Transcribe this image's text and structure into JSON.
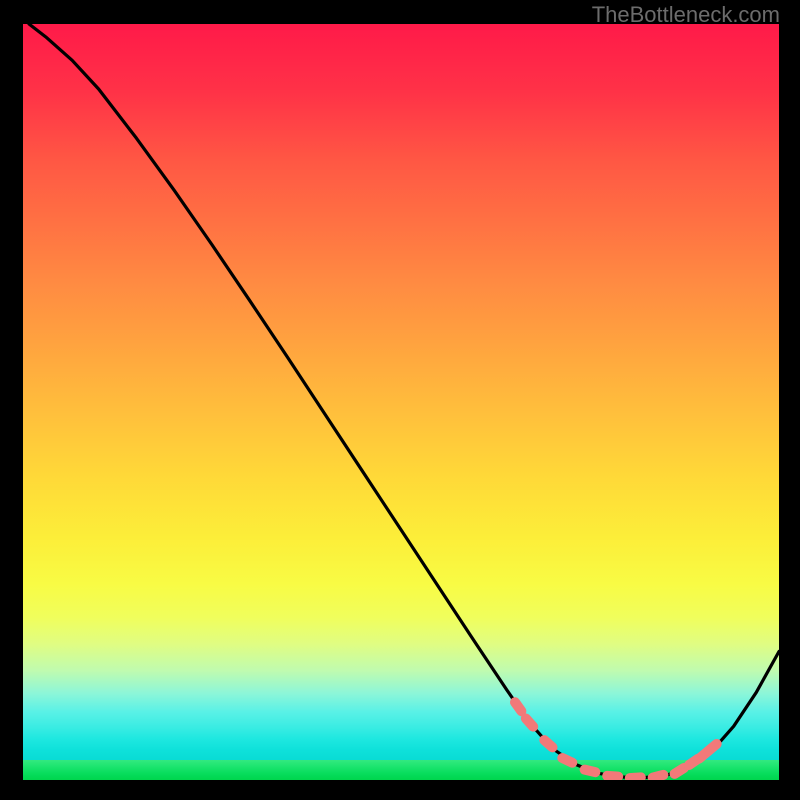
{
  "attribution": "TheBottleneck.com",
  "chart_data": {
    "type": "line",
    "title": "",
    "xlabel": "",
    "ylabel": "",
    "xlim": [
      0,
      100
    ],
    "ylim": [
      0,
      100
    ],
    "series": [
      {
        "name": "curve",
        "x": [
          0.8,
          3.0,
          6.5,
          10.0,
          15.0,
          20.0,
          25.0,
          30.0,
          35.0,
          40.0,
          45.0,
          50.0,
          55.0,
          60.0,
          64.0,
          67.0,
          70.0,
          73.0,
          76.0,
          79.0,
          82.0,
          85.0,
          88.0,
          91.0,
          94.0,
          97.0,
          100.0
        ],
        "y": [
          100.0,
          98.3,
          95.2,
          91.4,
          84.9,
          78.0,
          70.8,
          63.4,
          55.9,
          48.3,
          40.7,
          33.1,
          25.5,
          17.9,
          11.9,
          7.6,
          4.2,
          2.1,
          0.9,
          0.4,
          0.3,
          0.6,
          1.6,
          3.7,
          7.1,
          11.6,
          17.0
        ]
      }
    ],
    "markers": {
      "name": "highlight-band",
      "x": [
        65.5,
        67.0,
        69.5,
        72.0,
        75.0,
        78.0,
        81.0,
        84.0,
        86.8,
        88.7,
        90.0,
        91.2
      ],
      "y": [
        9.7,
        7.6,
        4.8,
        2.6,
        1.2,
        0.5,
        0.3,
        0.5,
        1.2,
        2.4,
        3.3,
        4.3
      ]
    },
    "colors": {
      "curve": "#000000",
      "marker": "#f27979",
      "gradient_top": "#ff1a49",
      "gradient_mid": "#ffd938",
      "gradient_bottom": "#00d54d"
    }
  }
}
